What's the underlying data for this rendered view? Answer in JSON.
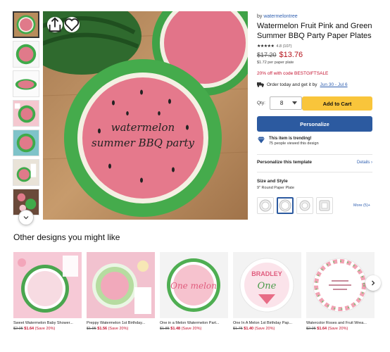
{
  "product": {
    "by_label": "by",
    "brand": "watermelontree",
    "title": "Watermelon Fruit Pink and Green Summer BBQ Party Paper Plates",
    "stars": "★★★★★",
    "rating": "4.8 (107)",
    "old_price": "$17.20",
    "new_price": "$13.76",
    "per_item": "$1.72 per paper plate",
    "promo": "20% off with code BESTGIFTSALE",
    "ship_text": "Order today and get it by",
    "ship_date": "Jun 30 - Jul 6",
    "main_image_text_line1": "watermelon",
    "main_image_text_line2": "summer BBQ party"
  },
  "purchase": {
    "qty_label": "Qty:",
    "qty_value": "8",
    "add_to_cart": "Add to Cart",
    "personalize": "Personalize"
  },
  "trend": {
    "title": "This item is trending!",
    "subtitle": "75 people viewed this design"
  },
  "personalize_row": {
    "label": "Personalize this template",
    "details": "Details"
  },
  "size": {
    "title": "Size and Style",
    "value": "9\" Round Paper Plate",
    "more": "More (5)+"
  },
  "other": {
    "title": "Other designs you might like",
    "cards": [
      {
        "title": "Sweet Watermelon Baby Shower...",
        "old": "$2.05",
        "new": "$1.64",
        "save": "(Save 20%)"
      },
      {
        "title": "Preppy Watermelon 1st Birthday...",
        "old": "$1.95",
        "new": "$1.56",
        "save": "(Save 20%)"
      },
      {
        "title": "One in a Melon Watermelon Part...",
        "old": "$1.85",
        "new": "$1.48",
        "save": "(Save 20%)"
      },
      {
        "title": "One In A Melon 1st Birthday Pap...",
        "old": "$1.75",
        "new": "$1.40",
        "save": "(Save 20%)"
      },
      {
        "title": "Watercolor Roses and Fruit Wrea...",
        "old": "$2.05",
        "new": "$1.64",
        "save": "(Save 20%)"
      }
    ],
    "card2_text": "One melon",
    "card3_name": "BRADLEY",
    "card3_text": "One"
  },
  "colors": {
    "accent_blue": "#2c5aa0",
    "cart_yellow": "#f9c53b",
    "sale_red": "#c4122f"
  }
}
